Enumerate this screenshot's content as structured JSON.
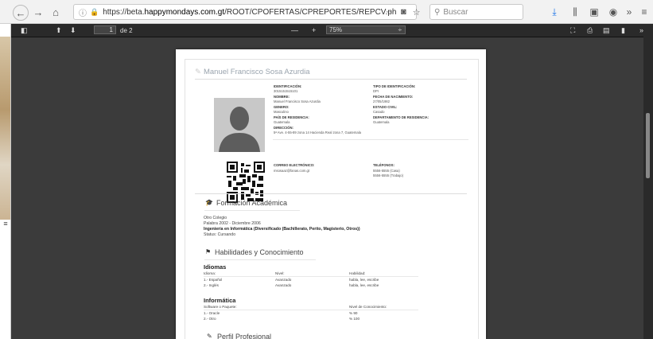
{
  "browser": {
    "url_prefix": "https://beta.",
    "url_domain": "happymondays.com.gt",
    "url_path": "/ROOT/CPOFERTAS/CPREPORTES/REPCV.ph",
    "more_label": "···",
    "search_placeholder": "Buscar"
  },
  "pdf_toolbar": {
    "page_number": "1",
    "page_of": "de 2",
    "zoom_minus": "—",
    "zoom_plus": "+",
    "zoom_value": "75%",
    "zoom_caret": "÷",
    "overflow": "»"
  },
  "cv": {
    "name": "Manuel Francisco Sosa Azurdia",
    "fields": {
      "identificacion_label": "IDENTIFICACIÓN:",
      "identificacion_value": "3015151515101",
      "tipo_label": "TIPO DE IDENTIFICACIÓN:",
      "tipo_value": "DPI",
      "nombre_label": "NOMBRE:",
      "nombre_value": "Manuel Francisco Sosa Azurdia",
      "fecha_label": "FECHA DE NACIMIENTO:",
      "fecha_value": "27/05/1982",
      "genero_label": "GENERO:",
      "genero_value": "Masculino",
      "estado_label": "ESTADO CIVIL:",
      "estado_value": "Casado",
      "pais_label": "PAÍS DE RESIDENCIA:",
      "pais_value": "Guatemala",
      "depto_label": "DEPARTAMENTO DE RESIDENCIA:",
      "depto_value": "Guatemala",
      "direccion_label": "DIRECCIÓN:",
      "direccion_value": "5ª Ave. 4-55-89 zona 14 Hacienda Real zona 7, Guatemala",
      "correo_label": "CORREO ELECTRÓNICO:",
      "correo_value": "msosaaz@fanas.com.gt",
      "telefonos_label": "TELÉFONOS:",
      "telefono_1": "5556-5555 (Casa)",
      "telefono_2": "5556-5555 (Trabajo)"
    },
    "formacion": {
      "title": "Formación Académica",
      "school": "Otro Colegio",
      "period": "Palabra 2002 - Diciembre 2006",
      "degree": "Ingeniería en Informática (Diversificado (Bachillerato, Perito, Magisterio, Otros))",
      "status": "Status: Cursando"
    },
    "habilidades": {
      "title": "Habilidades y Conocimiento",
      "idiomas_title": "Idiomas",
      "idiomas_headers": [
        "Idioma:",
        "Nivel:",
        "Habilidad:"
      ],
      "idiomas_rows": [
        [
          "1.- Español",
          "Avanzado",
          "habla, lee, escribe"
        ],
        [
          "2.- Inglés",
          "Avanzado",
          "habla, lee, escribe"
        ]
      ],
      "informatica_title": "Informática",
      "informatica_headers": [
        "Software o Paquete:",
        "Nivel de Conocimiento:"
      ],
      "informatica_rows": [
        [
          "1.- Oracle",
          "% 90"
        ],
        [
          "2.- Otro",
          "% 100"
        ]
      ]
    },
    "perfil_title": "Perfil Profesional"
  }
}
